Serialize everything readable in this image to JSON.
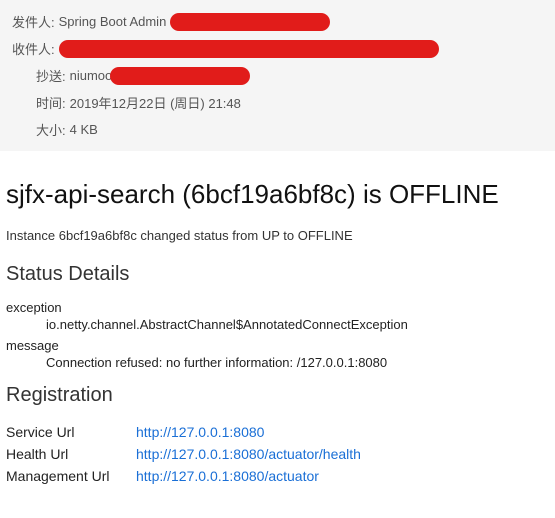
{
  "header": {
    "from_label": "发件人:",
    "from_value": "Spring Boot Admin",
    "to_label": "收件人:",
    "cc_label": "抄送:",
    "cc_value": "niumoo",
    "time_label": "时间:",
    "time_value": "2019年12月22日 (周日) 21:48",
    "size_label": "大小:",
    "size_value": "4 KB"
  },
  "body": {
    "title": "sjfx-api-search (6bcf19a6bf8c) is OFFLINE",
    "instance_line": "Instance 6bcf19a6bf8c changed status from UP to OFFLINE",
    "status_heading": "Status Details",
    "status": {
      "exception_key": "exception",
      "exception_val": "io.netty.channel.AbstractChannel$AnnotatedConnectException",
      "message_key": "message",
      "message_val": "Connection refused: no further information: /127.0.0.1:8080"
    },
    "registration_heading": "Registration",
    "registration": {
      "service_label": "Service Url",
      "service_url": "http://127.0.0.1:8080",
      "health_label": "Health Url",
      "health_url": "http://127.0.0.1:8080/actuator/health",
      "management_label": "Management Url",
      "management_url": "http://127.0.0.1:8080/actuator"
    }
  }
}
